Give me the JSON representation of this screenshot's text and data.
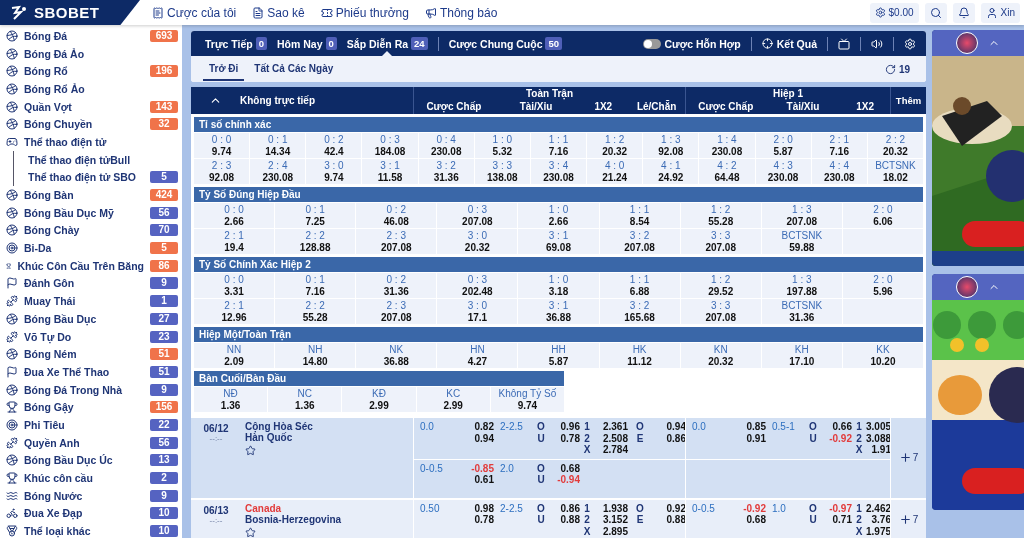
{
  "top_bar": {
    "logo": "SBOBET",
    "links": [
      "Cược của tôi",
      "Sao kê",
      "Phiếu thưởng",
      "Thông báo"
    ],
    "balance": "$0.00",
    "greeting": "Xin"
  },
  "sidebar": {
    "items": [
      {
        "label": "Bóng Đá",
        "count": "693",
        "color": "#f0734a"
      },
      {
        "label": "Bóng Đá Ảo"
      },
      {
        "label": "Bóng Rổ",
        "count": "196",
        "color": "#f0734a"
      },
      {
        "label": "Bóng Rổ Ảo"
      },
      {
        "label": "Quần Vợt",
        "count": "143",
        "color": "#f0734a"
      },
      {
        "label": "Bóng Chuyền",
        "count": "32",
        "color": "#f0734a"
      },
      {
        "label": "Thể thao điện tử",
        "children": [
          {
            "label": "Thể thao điện tửBull"
          },
          {
            "label": "Thể thao điện tử SBO",
            "count": "5",
            "color": "#5563c1"
          }
        ]
      },
      {
        "label": "Bóng Bàn",
        "count": "424",
        "color": "#f0734a"
      },
      {
        "label": "Bóng Bầu Dục Mỹ",
        "count": "56",
        "color": "#5563c1"
      },
      {
        "label": "Bóng Chày",
        "count": "70",
        "color": "#5563c1"
      },
      {
        "label": "Bi-Da",
        "count": "5",
        "color": "#f0734a"
      },
      {
        "label": "Khúc Côn Cầu Trên Băng",
        "count": "86",
        "color": "#f0734a"
      },
      {
        "label": "Đánh Gôn",
        "count": "9",
        "color": "#5563c1"
      },
      {
        "label": "Muay Thái",
        "count": "1",
        "color": "#5563c1"
      },
      {
        "label": "Bóng Bầu Dục",
        "count": "27",
        "color": "#5563c1"
      },
      {
        "label": "Võ Tự Do",
        "count": "23",
        "color": "#5563c1"
      },
      {
        "label": "Bóng Ném",
        "count": "51",
        "color": "#f0734a"
      },
      {
        "label": "Đua Xe Thể Thao",
        "count": "51",
        "color": "#5563c1"
      },
      {
        "label": "Bóng Đá Trong Nhà",
        "count": "9",
        "color": "#5563c1"
      },
      {
        "label": "Bóng Gậy",
        "count": "156",
        "color": "#f0734a"
      },
      {
        "label": "Phi Tiêu",
        "count": "22",
        "color": "#5563c1"
      },
      {
        "label": "Quyền Anh",
        "count": "56",
        "color": "#5563c1"
      },
      {
        "label": "Bóng Bầu Dục Úc",
        "count": "13",
        "color": "#5563c1"
      },
      {
        "label": "Khúc côn cầu",
        "count": "2",
        "color": "#5563c1"
      },
      {
        "label": "Bóng Nước",
        "count": "9",
        "color": "#5563c1"
      },
      {
        "label": "Đua Xe Đạp",
        "count": "10",
        "color": "#5563c1"
      },
      {
        "label": "Thể loại khác",
        "count": "10",
        "color": "#5563c1"
      }
    ]
  },
  "nav": {
    "tabs": [
      {
        "label": "Trực Tiếp",
        "count": "0",
        "selected": false
      },
      {
        "label": "Hôm Nay",
        "count": "0",
        "selected": false
      },
      {
        "label": "Sắp Diễn Ra",
        "count": "24",
        "selected": true
      },
      {
        "label": "Cược Chung Cuộc",
        "count": "50",
        "selected": false
      }
    ],
    "parlay": {
      "label": "Cược Hỗn Hợp",
      "on": false
    },
    "results": "Kết Quả"
  },
  "subnav": {
    "tabs": [
      {
        "label": "Trở Đi",
        "selected": true
      },
      {
        "label": "Tất Cả Các Ngày",
        "selected": false
      }
    ],
    "refresh": "19"
  },
  "table_header": {
    "title": "Không trực tiếp",
    "groups": [
      {
        "title": "Toàn Trận",
        "columns": [
          "Cược Chấp",
          "Tài/Xỉu",
          "1X2",
          "Lẻ/Chẵn"
        ]
      },
      {
        "title": "Hiệp 1",
        "columns": [
          "Cược Chấp",
          "Tài/Xỉu",
          "1X2"
        ]
      }
    ],
    "more": "Thêm"
  },
  "sections": [
    {
      "title": "Tỉ số chính xác",
      "rows": [
        [
          [
            "0 : 0",
            "9.74"
          ],
          [
            "0 : 1",
            "14.34"
          ],
          [
            "0 : 2",
            "42.4"
          ],
          [
            "0 : 3",
            "184.08"
          ],
          [
            "0 : 4",
            "230.08"
          ],
          [
            "1 : 0",
            "5.32"
          ],
          [
            "1 : 1",
            "7.16"
          ],
          [
            "1 : 2",
            "20.32"
          ],
          [
            "1 : 3",
            "92.08"
          ],
          [
            "1 : 4",
            "230.08"
          ],
          [
            "2 : 0",
            "5.87"
          ],
          [
            "2 : 1",
            "7.16"
          ],
          [
            "2 : 2",
            "20.32"
          ]
        ],
        [
          [
            "2 : 3",
            "92.08"
          ],
          [
            "2 : 4",
            "230.08"
          ],
          [
            "3 : 0",
            "9.74"
          ],
          [
            "3 : 1",
            "11.58"
          ],
          [
            "3 : 2",
            "31.36"
          ],
          [
            "3 : 3",
            "138.08"
          ],
          [
            "3 : 4",
            "230.08"
          ],
          [
            "4 : 0",
            "21.24"
          ],
          [
            "4 : 1",
            "24.92"
          ],
          [
            "4 : 2",
            "64.48"
          ],
          [
            "4 : 3",
            "230.08"
          ],
          [
            "4 : 4",
            "230.08"
          ],
          [
            "BCTSNK",
            "18.02"
          ]
        ]
      ]
    },
    {
      "title": "Tỷ Số Đúng Hiệp Đầu",
      "rows": [
        [
          [
            "0 : 0",
            "2.66"
          ],
          [
            "0 : 1",
            "7.25"
          ],
          [
            "0 : 2",
            "46.08"
          ],
          [
            "0 : 3",
            "207.08"
          ],
          [
            "1 : 0",
            "2.66"
          ],
          [
            "1 : 1",
            "8.54"
          ],
          [
            "1 : 2",
            "55.28"
          ],
          [
            "1 : 3",
            "207.08"
          ],
          [
            "2 : 0",
            "6.06"
          ]
        ],
        [
          [
            "2 : 1",
            "19.4"
          ],
          [
            "2 : 2",
            "128.88"
          ],
          [
            "2 : 3",
            "207.08"
          ],
          [
            "3 : 0",
            "20.32"
          ],
          [
            "3 : 1",
            "69.08"
          ],
          [
            "3 : 2",
            "207.08"
          ],
          [
            "3 : 3",
            "207.08"
          ],
          [
            "BCTSNK",
            "59.88"
          ]
        ]
      ]
    },
    {
      "title": "Tỷ Số Chính Xác Hiệp 2",
      "rows": [
        [
          [
            "0 : 0",
            "3.31"
          ],
          [
            "0 : 1",
            "7.16"
          ],
          [
            "0 : 2",
            "31.36"
          ],
          [
            "0 : 3",
            "202.48"
          ],
          [
            "1 : 0",
            "3.18"
          ],
          [
            "1 : 1",
            "6.88"
          ],
          [
            "1 : 2",
            "29.52"
          ],
          [
            "1 : 3",
            "197.88"
          ],
          [
            "2 : 0",
            "5.96"
          ]
        ],
        [
          [
            "2 : 1",
            "12.96"
          ],
          [
            "2 : 2",
            "55.28"
          ],
          [
            "2 : 3",
            "207.08"
          ],
          [
            "3 : 0",
            "17.1"
          ],
          [
            "3 : 1",
            "36.88"
          ],
          [
            "3 : 2",
            "165.68"
          ],
          [
            "3 : 3",
            "207.08"
          ],
          [
            "BCTSNK",
            "31.36"
          ]
        ]
      ]
    },
    {
      "title": "Hiệp Một/Toàn Trận",
      "rows": [
        [
          [
            "NN",
            "2.09"
          ],
          [
            "NH",
            "14.80"
          ],
          [
            "NK",
            "36.88"
          ],
          [
            "HN",
            "4.27"
          ],
          [
            "HH",
            "5.87"
          ],
          [
            "HK",
            "11.12"
          ],
          [
            "KN",
            "20.32"
          ],
          [
            "KH",
            "17.10"
          ],
          [
            "KK",
            "10.20"
          ]
        ]
      ]
    },
    {
      "title": "Bàn Cuối/Bàn Đầu",
      "rows": [
        [
          [
            "NĐ",
            "1.36"
          ],
          [
            "NC",
            "1.36"
          ],
          [
            "KĐ",
            "2.99"
          ],
          [
            "KC",
            "2.99"
          ],
          [
            "Không Tỷ Số",
            "9.74"
          ]
        ]
      ]
    }
  ],
  "matches": [
    {
      "date": "06/12",
      "time": "--:--",
      "teams": [
        {
          "name": "Cộng Hòa Séc",
          "favored": false
        },
        {
          "name": "Hàn Quốc",
          "favored": false
        }
      ],
      "starred": false,
      "more": "7",
      "lines": [
        {
          "full": {
            "hdp": "0.0",
            "hdp_odds": [
              "0.82",
              "0.94"
            ],
            "ou": "2-2.5",
            "ou_odds": [
              {
                "label": "O",
                "value": "0.96"
              },
              {
                "label": "U",
                "value": "0.78"
              }
            ],
            "x12": [
              {
                "label": "1",
                "value": "2.361"
              },
              {
                "label": "2",
                "value": "2.508"
              },
              {
                "label": "X",
                "value": "2.784"
              }
            ],
            "oe": [
              {
                "label": "O",
                "value": "0.94"
              },
              {
                "label": "E",
                "value": "0.86"
              }
            ]
          },
          "half": {
            "hdp": "0.0",
            "hdp_odds": [
              "0.85",
              "0.91"
            ],
            "ou": "0.5-1",
            "ou_odds": [
              {
                "label": "O",
                "value": "0.66"
              },
              {
                "label": "U",
                "value": "-0.92"
              }
            ],
            "x12": [
              {
                "label": "1",
                "value": "3.005"
              },
              {
                "label": "2",
                "value": "3.088"
              },
              {
                "label": "X",
                "value": "1.91"
              }
            ]
          }
        },
        {
          "full": {
            "hdp": "0-0.5",
            "hdp_odds": [
              "-0.85",
              "0.61"
            ],
            "ou": "2.0",
            "ou_odds": [
              {
                "label": "O",
                "value": "0.68"
              },
              {
                "label": "U",
                "value": "-0.94"
              }
            ]
          }
        }
      ]
    },
    {
      "date": "06/13",
      "time": "--:--",
      "teams": [
        {
          "name": "Canada",
          "favored": true
        },
        {
          "name": "Bosnia-Herzegovina",
          "favored": false
        }
      ],
      "starred": false,
      "more": "7",
      "lines": [
        {
          "full": {
            "hdp": "0.50",
            "hdp_odds": [
              "0.98",
              "0.78"
            ],
            "ou": "2-2.5",
            "ou_odds": [
              {
                "label": "O",
                "value": "0.86"
              },
              {
                "label": "U",
                "value": "0.88"
              }
            ],
            "x12": [
              {
                "label": "1",
                "value": "1.938"
              },
              {
                "label": "2",
                "value": "3.152"
              },
              {
                "label": "X",
                "value": "2.895"
              }
            ],
            "oe": [
              {
                "label": "O",
                "value": "0.92"
              },
              {
                "label": "E",
                "value": "0.88"
              }
            ]
          },
          "half": {
            "hdp": "0-0.5",
            "hdp_odds": [
              "-0.92",
              "0.68"
            ],
            "ou": "1.0",
            "ou_odds": [
              {
                "label": "O",
                "value": "-0.97"
              },
              {
                "label": "U",
                "value": "0.71"
              }
            ],
            "x12": [
              {
                "label": "1",
                "value": "2.462"
              },
              {
                "label": "2",
                "value": "3.76"
              },
              {
                "label": "X",
                "value": "1.975"
              }
            ]
          }
        }
      ]
    }
  ]
}
